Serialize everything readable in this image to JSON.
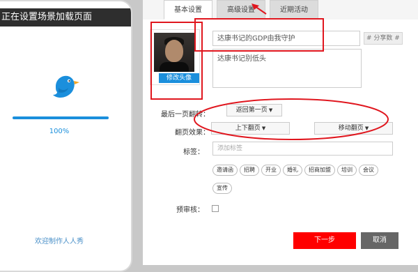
{
  "phone": {
    "title": "正在设置场景加载页面",
    "progress_percent": 100,
    "progress_label": "100%",
    "footer_text": "欢迎制作人人秀",
    "icon": "bird-logo-icon"
  },
  "tabs": [
    {
      "label": "基本设置",
      "active": true
    },
    {
      "label": "高级设置",
      "active": false
    },
    {
      "label": "近期活动",
      "active": false
    }
  ],
  "basic": {
    "avatar_button": "修改头像",
    "title_value": "达康书记的GDP由我守护",
    "share_tag": "# 分享数 #",
    "description_value": "达康书记别低头"
  },
  "fields": {
    "last_page_label": "最后一页翻转：",
    "last_page_value": "返回第一页",
    "page_effect_label": "翻页效果：",
    "effect_option_1": "上下翻页",
    "effect_option_2": "移动翻页",
    "tags_label": "标签：",
    "tags_placeholder": "添加标签",
    "preview_label": "预审核："
  },
  "tag_chips": [
    "邀请函",
    "招聘",
    "开业",
    "婚礼",
    "招商加盟",
    "培训",
    "会议",
    "宣传"
  ],
  "actions": {
    "next_label": "下一步",
    "cancel_label": "取消"
  },
  "colors": {
    "accent_blue": "#1b8fdc",
    "annotation_red": "#e0161e",
    "next_button": "#ff0000"
  }
}
